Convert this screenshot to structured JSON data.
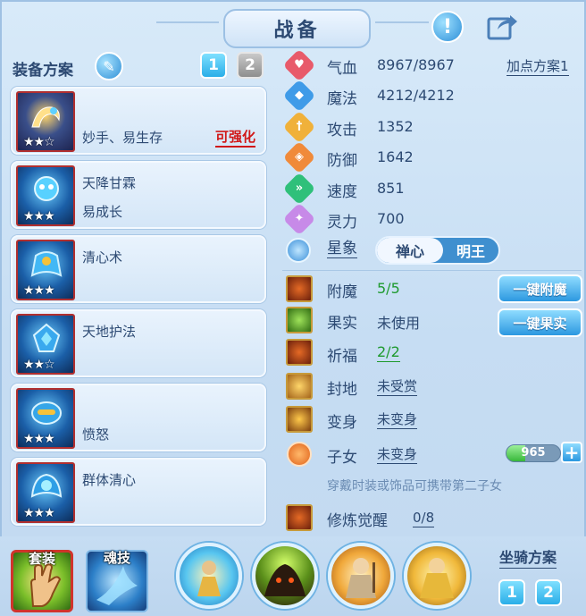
{
  "header": {
    "title": "战备"
  },
  "equip_plan": {
    "label": "装备方案",
    "pages": [
      "1",
      "2"
    ],
    "items": [
      {
        "line1": "",
        "line2": "妙手、易生存",
        "stars": "★★☆",
        "enhance": "可强化"
      },
      {
        "line1": "天降甘霖",
        "line2": "易成长",
        "stars": "★★★",
        "enhance": ""
      },
      {
        "line1": "清心术",
        "line2": "",
        "stars": "★★★",
        "enhance": ""
      },
      {
        "line1": "天地护法",
        "line2": "",
        "stars": "★★☆",
        "enhance": ""
      },
      {
        "line1": "",
        "line2": "愤怒",
        "stars": "★★★",
        "enhance": ""
      },
      {
        "line1": "群体清心",
        "line2": "",
        "stars": "★★★",
        "enhance": ""
      }
    ]
  },
  "stats": {
    "plan_link": "加点方案1",
    "items": [
      {
        "label": "气血",
        "value": "8967/8967",
        "icon": "heart-icon",
        "color": "#e85a6a"
      },
      {
        "label": "魔法",
        "value": "4212/4212",
        "icon": "mana-icon",
        "color": "#3f9be8"
      },
      {
        "label": "攻击",
        "value": "1352",
        "icon": "sword-icon",
        "color": "#f0b13a"
      },
      {
        "label": "防御",
        "value": "1642",
        "icon": "shield-icon",
        "color": "#f08a3a"
      },
      {
        "label": "速度",
        "value": "851",
        "icon": "speed-icon",
        "color": "#2fc07a"
      },
      {
        "label": "灵力",
        "value": "700",
        "icon": "spirit-icon",
        "color": "#c78ae8"
      }
    ],
    "star_sign": {
      "label": "星象",
      "options": [
        "禅心",
        "明王"
      ],
      "selected": "禅心"
    }
  },
  "features": {
    "items": [
      {
        "label": "附魔",
        "value": "5/5",
        "green": true,
        "icon": "enchant-icon"
      },
      {
        "label": "果实",
        "value": "未使用",
        "green": false,
        "icon": "fruit-icon"
      },
      {
        "label": "祈福",
        "value": "2/2",
        "green": true,
        "icon": "blessing-icon"
      },
      {
        "label": "封地",
        "value": "未受赏",
        "green": false,
        "icon": "fief-icon"
      },
      {
        "label": "变身",
        "value": "未变身",
        "green": false,
        "icon": "transform-icon"
      },
      {
        "label": "子女",
        "value": "未变身",
        "green": false,
        "icon": "child-icon"
      },
      {
        "label": "修炼觉醒",
        "value": "0/8",
        "green": false,
        "icon": "cultivation-icon"
      }
    ],
    "btn_enchant": "一键附魔",
    "btn_fruit": "一键果实",
    "child_exp": {
      "value": "965",
      "fill_fraction": 0.35
    },
    "hint": "穿戴时装或饰品可携带第二子女"
  },
  "bottom": {
    "suit_label": "套装",
    "soul_label": "魂技",
    "mount_label": "坐骑方案",
    "mount_pages": [
      "1",
      "2"
    ]
  }
}
